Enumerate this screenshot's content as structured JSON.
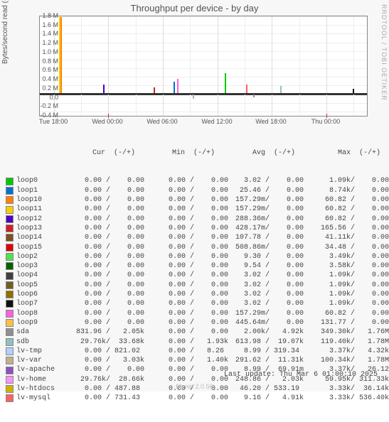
{
  "chart_data": {
    "type": "line",
    "title": "Throughput per device - by day",
    "ylabel": "Bytes/second read (-) / write (+)",
    "ylim": [
      -500000,
      1800000
    ],
    "yticks": [
      "-0.4 M",
      "-0.2 M",
      "0.0",
      "0.2 M",
      "0.4 M",
      "0.6 M",
      "0.8 M",
      "1.0 M",
      "1.2 M",
      "1.4 M",
      "1.6 M",
      "1.8 M"
    ],
    "xticks": [
      "Tue 18:00",
      "Wed 00:00",
      "Wed 06:00",
      "Wed 12:00",
      "Wed 18:00",
      "Thu 00:00"
    ],
    "column_headers": [
      "Cur  (-/+)",
      "Min  (-/+)",
      "Avg  (-/+)",
      "Max  (-/+)"
    ],
    "series": [
      {
        "name": "loop0",
        "color": "#00c800",
        "cur": "   0.00 /    0.00",
        "min": "   0.00 /    0.00",
        "avg": "   3.02 /    0.00",
        "max": "   1.09k/    0.00"
      },
      {
        "name": "loop1",
        "color": "#0070d0",
        "cur": "   0.00 /    0.00",
        "min": "   0.00 /    0.00",
        "avg": "  25.46 /    0.00",
        "max": "   8.74k/    0.00"
      },
      {
        "name": "loop10",
        "color": "#ff8000",
        "cur": "   0.00 /    0.00",
        "min": "   0.00 /    0.00",
        "avg": " 157.29m/    0.00",
        "max": "  60.82 /    0.00"
      },
      {
        "name": "loop11",
        "color": "#ffcc00",
        "cur": "   0.00 /    0.00",
        "min": "   0.00 /    0.00",
        "avg": " 157.29m/    0.00",
        "max": "  60.82 /    0.00"
      },
      {
        "name": "loop12",
        "color": "#5000c0",
        "cur": "   0.00 /    0.00",
        "min": "   0.00 /    0.00",
        "avg": " 288.36m/    0.00",
        "max": "  60.82 /    0.00"
      },
      {
        "name": "loop13",
        "color": "#d02020",
        "cur": "   0.00 /    0.00",
        "min": "   0.00 /    0.00",
        "avg": " 428.17m/    0.00",
        "max": " 165.56 /    0.00"
      },
      {
        "name": "loop14",
        "color": "#805020",
        "cur": "   0.00 /    0.00",
        "min": "   0.00 /    0.00",
        "avg": " 107.78 /    0.00",
        "max": "  41.11k/    0.00"
      },
      {
        "name": "loop15",
        "color": "#e00000",
        "cur": "   0.00 /    0.00",
        "min": "   0.00 /    0.00",
        "avg": " 508.86m/    0.00",
        "max": "  34.48 /    0.00"
      },
      {
        "name": "loop2",
        "color": "#50e050",
        "cur": "   0.00 /    0.00",
        "min": "   0.00 /    0.00",
        "avg": "   9.30 /    0.00",
        "max": "   3.49k/    0.00"
      },
      {
        "name": "loop3",
        "color": "#006000",
        "cur": "   0.00 /    0.00",
        "min": "   0.00 /    0.00",
        "avg": "   9.54 /    0.00",
        "max": "   3.58k/    0.00"
      },
      {
        "name": "loop4",
        "color": "#404040",
        "cur": "   0.00 /    0.00",
        "min": "   0.00 /    0.00",
        "avg": "   3.02 /    0.00",
        "max": "   1.09k/    0.00"
      },
      {
        "name": "loop5",
        "color": "#706020",
        "cur": "   0.00 /    0.00",
        "min": "   0.00 /    0.00",
        "avg": "   3.02 /    0.00",
        "max": "   1.09k/    0.00"
      },
      {
        "name": "loop6",
        "color": "#907000",
        "cur": "   0.00 /    0.00",
        "min": "   0.00 /    0.00",
        "avg": "   3.02 /    0.00",
        "max": "   1.09k/    0.00"
      },
      {
        "name": "loop7",
        "color": "#101010",
        "cur": "   0.00 /    0.00",
        "min": "   0.00 /    0.00",
        "avg": "   3.02 /    0.00",
        "max": "   1.09k/    0.00"
      },
      {
        "name": "loop8",
        "color": "#ff60e0",
        "cur": "   0.00 /    0.00",
        "min": "   0.00 /    0.00",
        "avg": " 157.29m/    0.00",
        "max": "  60.82 /    0.00"
      },
      {
        "name": "loop9",
        "color": "#ffc040",
        "cur": "   0.00 /    0.00",
        "min": "   0.00 /    0.00",
        "avg": " 445.64m/    0.00",
        "max": " 131.77 /    0.00"
      },
      {
        "name": "sda",
        "color": "#909090",
        "cur": " 831.96 /   2.05k",
        "min": "   0.00 /    0.00",
        "avg": "   2.00k/   4.92k",
        "max": " 349.30k/   1.76M"
      },
      {
        "name": "sdb",
        "color": "#90c0c0",
        "cur": "  29.76k/  33.68k",
        "min": "   0.00 /   1.93k",
        "avg": " 613.98 /  19.07k",
        "max": " 119.40k/   1.78M"
      },
      {
        "name": "lv-tmp",
        "color": "#b0d0ff",
        "cur": "   0.00 / 821.02",
        "min": "   0.00 /   8.26",
        "avg": "   8.99 / 319.34",
        "max": "   3.37k/   4.32k"
      },
      {
        "name": "lv-var",
        "color": "#c0b090",
        "cur": "   0.00 /   3.03k",
        "min": "   0.00 /   1.40k",
        "avg": " 291.62 /  11.31k",
        "max": " 100.34k/   1.78M"
      },
      {
        "name": "lv-apache",
        "color": "#9050c0",
        "cur": "   0.00 /    0.00",
        "min": "   0.00 /    0.00",
        "avg": "   8.99 /  69.91m",
        "max": "   3.37k/   26.12"
      },
      {
        "name": "lv-home",
        "color": "#ff90ff",
        "cur": "  29.76k/  28.66k",
        "min": "   0.00 /    0.00",
        "avg": " 248.86 /   2.03k",
        "max": "  59.95k/ 311.33k"
      },
      {
        "name": "lv-htdocs",
        "color": "#d0b000",
        "cur": "   0.00 / 487.88",
        "min": "   0.00 /    0.00",
        "avg": "  46.20 / 533.19",
        "max": "   3.33k/  36.14k"
      },
      {
        "name": "lv-mysql",
        "color": "#ff6060",
        "cur": "   0.00 / 731.43",
        "min": "   0.00 /    0.00",
        "avg": "   9.16 /   4.91k",
        "max": "   3.33k/ 536.40k"
      }
    ],
    "last_update": "Last update: Thu Mar  6 01:00:10 2025",
    "footer": "Munin 2.0.56",
    "watermark": "RRDTOOL / TOBI OETIKER"
  }
}
